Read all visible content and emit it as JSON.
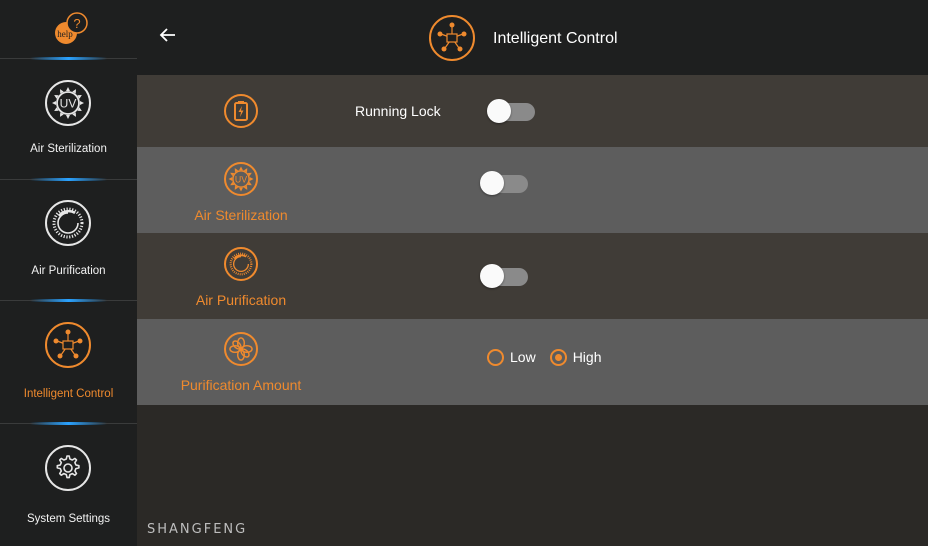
{
  "help": {
    "text": "help",
    "mark": "?"
  },
  "brand": "SHANGFENG",
  "sidebar": {
    "items": [
      {
        "label": "Air Sterilization",
        "icon": "uv-sun-icon",
        "active": false
      },
      {
        "label": "Air Purification",
        "icon": "air-purification-icon",
        "active": false
      },
      {
        "label": "Intelligent Control",
        "icon": "intelligent-control-icon",
        "active": true
      },
      {
        "label": "System Settings",
        "icon": "gear-icon",
        "active": false
      }
    ]
  },
  "header": {
    "title": "Intelligent Control",
    "icon": "intelligent-control-icon"
  },
  "rows": [
    {
      "label": "",
      "inline_label": "Running Lock",
      "icon": "battery-lock-icon",
      "control": "toggle",
      "on": false
    },
    {
      "label": "Air Sterilization",
      "icon": "uv-sun-icon",
      "control": "toggle",
      "on": false
    },
    {
      "label": "Air Purification",
      "icon": "air-purification-icon",
      "control": "toggle",
      "on": false
    },
    {
      "label": "Purification Amount",
      "icon": "fan-icon",
      "control": "radio",
      "options": [
        {
          "label": "Low",
          "checked": false
        },
        {
          "label": "High",
          "checked": true
        }
      ]
    }
  ],
  "colors": {
    "accent": "#ef8a2e",
    "sidebar_bg": "#1e1f1f",
    "row_dark": "#403c37",
    "row_light": "#5d5d5d",
    "divider_glow": "#2aa2ff",
    "toggle_track": "#8a8a8a"
  }
}
